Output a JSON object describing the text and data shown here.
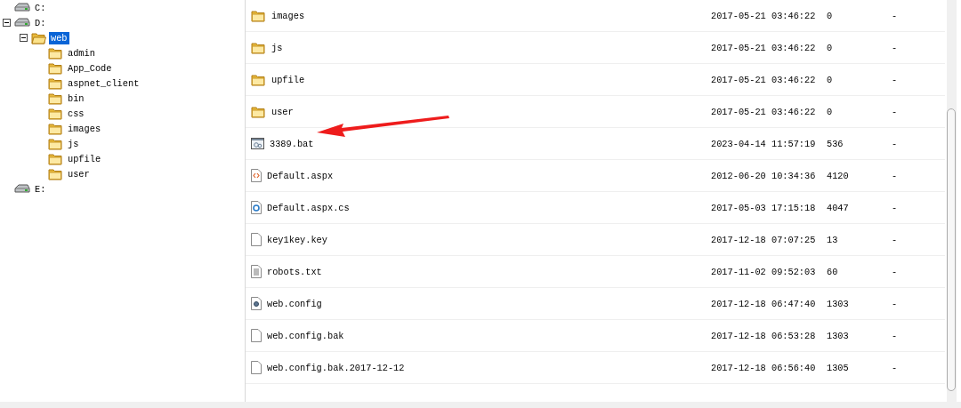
{
  "tree": [
    {
      "label": "C:",
      "kind": "drive",
      "selected": false
    },
    {
      "label": "D:",
      "kind": "drive",
      "selected": false,
      "expanded": true,
      "children": [
        {
          "label": "web",
          "kind": "folder",
          "selected": true,
          "expanded": true,
          "children": [
            {
              "label": "admin",
              "kind": "folder",
              "selected": false
            },
            {
              "label": "App_Code",
              "kind": "folder",
              "selected": false
            },
            {
              "label": "aspnet_client",
              "kind": "folder",
              "selected": false
            },
            {
              "label": "bin",
              "kind": "folder",
              "selected": false
            },
            {
              "label": "css",
              "kind": "folder",
              "selected": false
            },
            {
              "label": "images",
              "kind": "folder",
              "selected": false
            },
            {
              "label": "js",
              "kind": "folder",
              "selected": false
            },
            {
              "label": "upfile",
              "kind": "folder",
              "selected": false
            },
            {
              "label": "user",
              "kind": "folder",
              "selected": false
            }
          ]
        }
      ]
    },
    {
      "label": "E:",
      "kind": "drive",
      "selected": false
    }
  ],
  "files": [
    {
      "kind": "folder",
      "name": "images",
      "modified": "2017-05-21 03:46:22",
      "size": "0",
      "column_4": "-"
    },
    {
      "kind": "folder",
      "name": "js",
      "modified": "2017-05-21 03:46:22",
      "size": "0",
      "column_4": "-"
    },
    {
      "kind": "folder",
      "name": "upfile",
      "modified": "2017-05-21 03:46:22",
      "size": "0",
      "column_4": "-"
    },
    {
      "kind": "folder",
      "name": "user",
      "modified": "2017-05-21 03:46:22",
      "size": "0",
      "column_4": "-"
    },
    {
      "kind": "batch",
      "name": "3389.bat",
      "modified": "2023-04-14 11:57:19",
      "size": "536",
      "column_4": "-"
    },
    {
      "kind": "markup",
      "name": "Default.aspx",
      "modified": "2012-06-20 10:34:36",
      "size": "4120",
      "column_4": "-"
    },
    {
      "kind": "code",
      "name": "Default.aspx.cs",
      "modified": "2017-05-03 17:15:18",
      "size": "4047",
      "column_4": "-"
    },
    {
      "kind": "blank",
      "name": "key1key.key",
      "modified": "2017-12-18 07:07:25",
      "size": "13",
      "column_4": "-"
    },
    {
      "kind": "text",
      "name": "robots.txt",
      "modified": "2017-11-02 09:52:03",
      "size": "60",
      "column_4": "-"
    },
    {
      "kind": "config",
      "name": "web.config",
      "modified": "2017-12-18 06:47:40",
      "size": "1303",
      "column_4": "-"
    },
    {
      "kind": "blank",
      "name": "web.config.bak",
      "modified": "2017-12-18 06:53:28",
      "size": "1303",
      "column_4": "-"
    },
    {
      "kind": "blank",
      "name": "web.config.bak.2017-12-12",
      "modified": "2017-12-18 06:56:40",
      "size": "1305",
      "column_4": "-"
    }
  ]
}
